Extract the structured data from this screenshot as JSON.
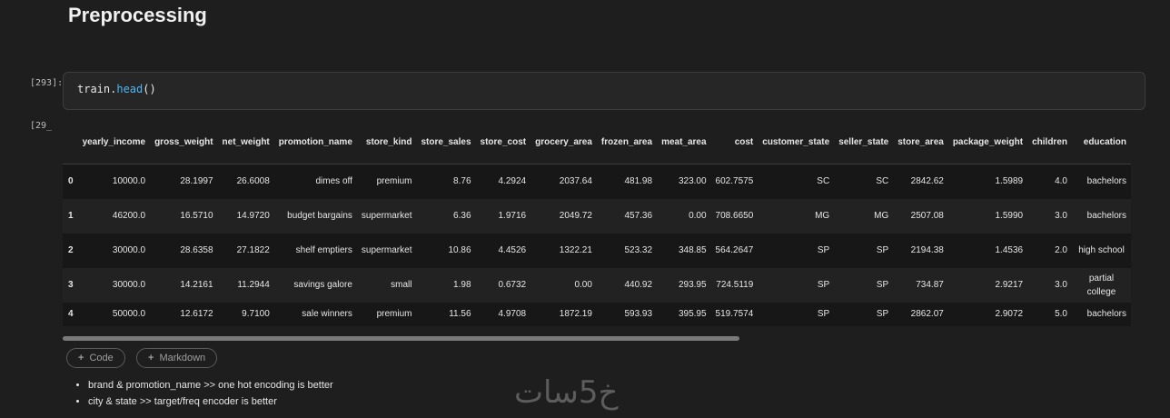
{
  "markdown": {
    "heading": "Preprocessing"
  },
  "code_cell": {
    "prompt": "[293]:",
    "object": "train",
    "dot": ".",
    "method": "head",
    "args": "()"
  },
  "output": {
    "prompt": "[29_",
    "columns": [
      "",
      "yearly_income",
      "gross_weight",
      "net_weight",
      "promotion_name",
      "store_kind",
      "store_sales",
      "store_cost",
      "grocery_area",
      "frozen_area",
      "meat_area",
      "cost",
      "customer_state",
      "seller_state",
      "store_area",
      "package_weight",
      "children",
      "education"
    ],
    "rows": [
      [
        "0",
        "10000.0",
        "28.1997",
        "26.6008",
        "dimes off",
        "premium",
        "8.76",
        "4.2924",
        "2037.64",
        "481.98",
        "323.00",
        "602.7575",
        "SC",
        "SC",
        "2842.62",
        "1.5989",
        "4.0",
        "bachelors"
      ],
      [
        "1",
        "46200.0",
        "16.5710",
        "14.9720",
        "budget bargains",
        "supermarket",
        "6.36",
        "1.9716",
        "2049.72",
        "457.36",
        "0.00",
        "708.6650",
        "MG",
        "MG",
        "2507.08",
        "1.5990",
        "3.0",
        "bachelors"
      ],
      [
        "2",
        "30000.0",
        "28.6358",
        "27.1822",
        "shelf emptiers",
        "supermarket",
        "10.86",
        "4.4526",
        "1322.21",
        "523.32",
        "348.85",
        "564.2647",
        "SP",
        "SP",
        "2194.38",
        "1.4536",
        "2.0",
        "high school"
      ],
      [
        "3",
        "30000.0",
        "14.2161",
        "11.2944",
        "savings galore",
        "small",
        "1.98",
        "0.6732",
        "0.00",
        "440.92",
        "293.95",
        "724.5119",
        "SP",
        "SP",
        "734.87",
        "2.9217",
        "3.0",
        "partial college"
      ],
      [
        "4",
        "50000.0",
        "12.6172",
        "9.7100",
        "sale winners",
        "premium",
        "11.56",
        "4.9708",
        "1872.19",
        "593.93",
        "395.95",
        "519.7574",
        "SP",
        "SP",
        "2862.07",
        "2.9072",
        "5.0",
        "bachelors"
      ]
    ]
  },
  "toolbar": {
    "add_code": "Code",
    "add_markdown": "Markdown"
  },
  "notes": [
    "brand & promotion_name >> one hot encoding is better",
    "city & state >> target/freq encoder is better"
  ],
  "watermark": "خ5سات",
  "colors": {
    "background": "#1e1e1e",
    "code_function": "#4fb5f6"
  }
}
